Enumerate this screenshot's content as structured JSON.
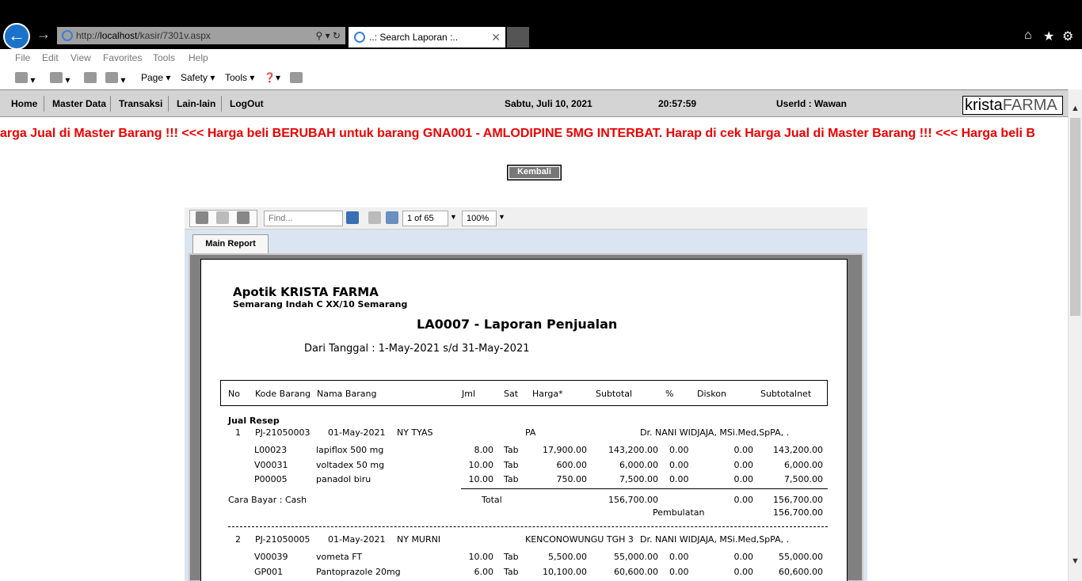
{
  "browser": {
    "url_prefix": "http://",
    "url_host": "localhost",
    "url_path": "/kasir/7301v.aspx",
    "tab_title": "..: Search Laporan :..",
    "menu": [
      "File",
      "Edit",
      "View",
      "Favorites",
      "Tools",
      "Help"
    ],
    "commands": {
      "page": "Page ▾",
      "safety": "Safety ▾",
      "tools": "Tools ▾"
    }
  },
  "nav": {
    "items": [
      "Home",
      "Master Data",
      "Transaksi",
      "Lain-lain",
      "LogOut"
    ],
    "date": "Sabtu, Juli 10, 2021",
    "time": "20:57:59",
    "user": "UserId : Wawan",
    "logo_a": "krista",
    "logo_b": "FARMA"
  },
  "marquee": "arga Jual di Master Barang !!!   <<<   Harga beli BERUBAH untuk barang GNA001 - AMLODIPINE 5MG INTERBAT. Harap di cek Harga Jual di Master Barang !!!   <<<   Harga beli B",
  "kembali_label": "Kembali",
  "viewer": {
    "find_placeholder": "Find...",
    "page_of": "1 of 65",
    "zoom": "100%",
    "tab": "Main Report"
  },
  "report": {
    "company": "Apotik KRISTA FARMA",
    "address": "Semarang Indah C XX/10 Semarang",
    "title": "LA0007 - Laporan Penjualan",
    "range": "Dari Tanggal : 1-May-2021 s/d 31-May-2021",
    "columns": [
      "No",
      "Kode Barang",
      "Nama Barang",
      "Jml",
      "Sat",
      "Harga*",
      "Subtotal",
      "%",
      "Diskon",
      "Subtotalnet"
    ],
    "section": "Jual Resep",
    "tx1": {
      "no": "1",
      "id": "PJ-21050003",
      "date": "01-May-2021",
      "name": "NY TYAS",
      "addr": "PA",
      "doctor": "Dr. NANI WIDJAJA, MSi.Med,SpPA, ."
    },
    "items1": [
      [
        "L00023",
        "lapiflox 500 mg",
        "8.00",
        "Tab",
        "17,900.00",
        "143,200.00",
        "0.00",
        "0.00",
        "143,200.00"
      ],
      [
        "V00031",
        "voltadex 50 mg",
        "10.00",
        "Tab",
        "600.00",
        "6,000.00",
        "0.00",
        "0.00",
        "6,000.00"
      ],
      [
        "P00005",
        "panadol biru",
        "10.00",
        "Tab",
        "750.00",
        "7,500.00",
        "0.00",
        "0.00",
        "7,500.00"
      ]
    ],
    "pay": "Cara Bayar : Cash",
    "total_label": "Total",
    "total_sub": "156,700.00",
    "total_disc": "0.00",
    "total_net": "156,700.00",
    "round_label": "Pembulatan",
    "round_val": "156,700.00",
    "tx2": {
      "no": "2",
      "id": "PJ-21050005",
      "date": "01-May-2021",
      "name": "NY MURNI",
      "addr": "KENCONOWUNGU TGH 3",
      "doctor": "Dr. NANI WIDJAJA, MSi.Med,SpPA, ."
    },
    "items2": [
      [
        "V00039",
        "vometa FT",
        "10.00",
        "Tab",
        "5,500.00",
        "55,000.00",
        "0.00",
        "0.00",
        "55,000.00"
      ],
      [
        "GP001",
        "Pantoprazole 20mg",
        "6.00",
        "Tab",
        "10,100.00",
        "60,600.00",
        "0.00",
        "0.00",
        "60,600.00"
      ]
    ]
  }
}
